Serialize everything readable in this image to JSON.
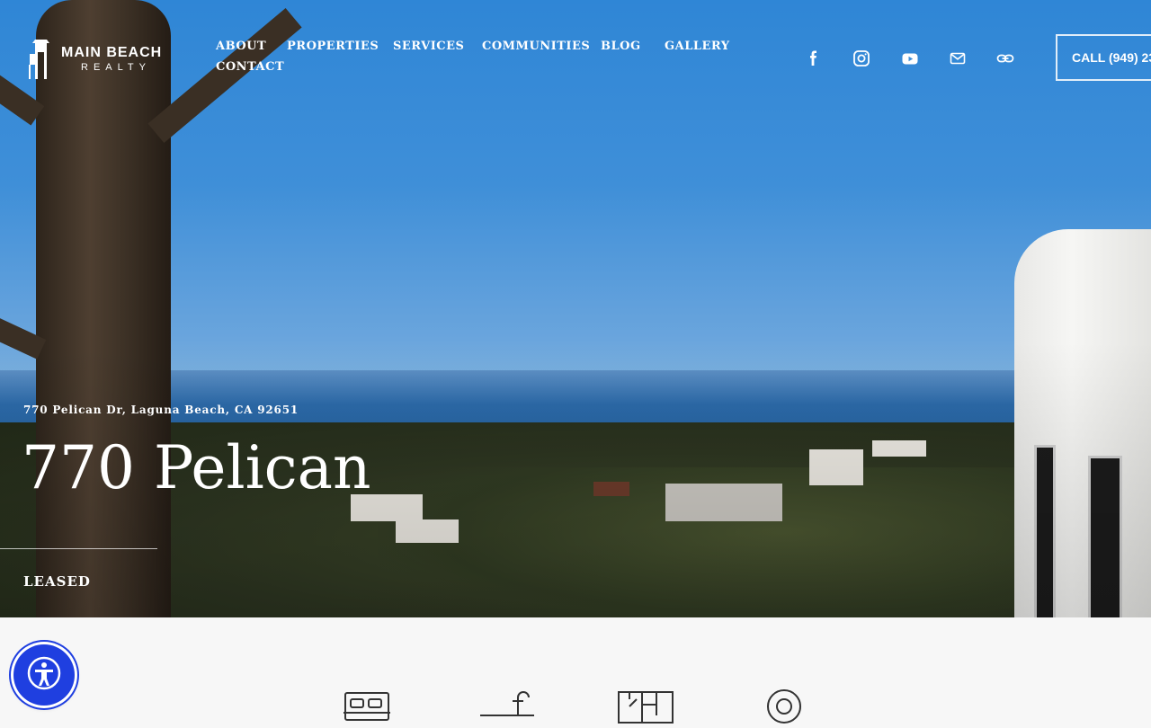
{
  "brand": {
    "line1": "MAIN BEACH",
    "line2": "REALTY"
  },
  "nav": {
    "items": [
      "ABOUT",
      "PROPERTIES",
      "SERVICES",
      "COMMUNITIES",
      "BLOG",
      "GALLERY",
      "CONTACT"
    ]
  },
  "social": [
    "facebook-icon",
    "instagram-icon",
    "youtube-icon",
    "mail-icon",
    "link-icon"
  ],
  "cta": {
    "call_label": "CALL (949) 23"
  },
  "hero": {
    "address": "770 Pelican Dr, Laguna Beach, CA 92651",
    "title": "770 Pelican",
    "status": "LEASED"
  },
  "features": [
    "bed-icon",
    "bath-icon",
    "floorplan-icon",
    "location-icon"
  ],
  "colors": {
    "accessibility_blue": "#1f3fe0",
    "text_white": "#ffffff"
  }
}
